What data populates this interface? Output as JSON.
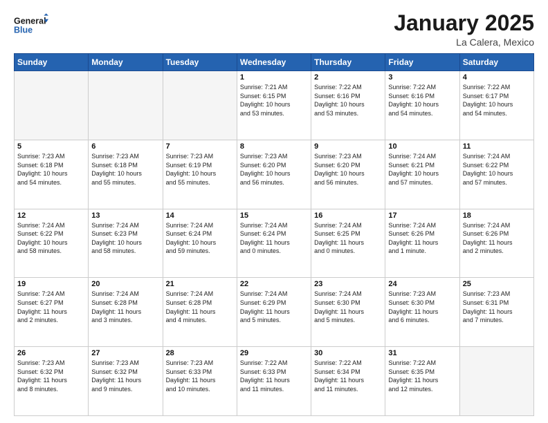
{
  "header": {
    "logo_line1": "General",
    "logo_line2": "Blue",
    "title": "January 2025",
    "subtitle": "La Calera, Mexico"
  },
  "weekdays": [
    "Sunday",
    "Monday",
    "Tuesday",
    "Wednesday",
    "Thursday",
    "Friday",
    "Saturday"
  ],
  "weeks": [
    [
      {
        "day": "",
        "info": ""
      },
      {
        "day": "",
        "info": ""
      },
      {
        "day": "",
        "info": ""
      },
      {
        "day": "1",
        "info": "Sunrise: 7:21 AM\nSunset: 6:15 PM\nDaylight: 10 hours\nand 53 minutes."
      },
      {
        "day": "2",
        "info": "Sunrise: 7:22 AM\nSunset: 6:16 PM\nDaylight: 10 hours\nand 53 minutes."
      },
      {
        "day": "3",
        "info": "Sunrise: 7:22 AM\nSunset: 6:16 PM\nDaylight: 10 hours\nand 54 minutes."
      },
      {
        "day": "4",
        "info": "Sunrise: 7:22 AM\nSunset: 6:17 PM\nDaylight: 10 hours\nand 54 minutes."
      }
    ],
    [
      {
        "day": "5",
        "info": "Sunrise: 7:23 AM\nSunset: 6:18 PM\nDaylight: 10 hours\nand 54 minutes."
      },
      {
        "day": "6",
        "info": "Sunrise: 7:23 AM\nSunset: 6:18 PM\nDaylight: 10 hours\nand 55 minutes."
      },
      {
        "day": "7",
        "info": "Sunrise: 7:23 AM\nSunset: 6:19 PM\nDaylight: 10 hours\nand 55 minutes."
      },
      {
        "day": "8",
        "info": "Sunrise: 7:23 AM\nSunset: 6:20 PM\nDaylight: 10 hours\nand 56 minutes."
      },
      {
        "day": "9",
        "info": "Sunrise: 7:23 AM\nSunset: 6:20 PM\nDaylight: 10 hours\nand 56 minutes."
      },
      {
        "day": "10",
        "info": "Sunrise: 7:24 AM\nSunset: 6:21 PM\nDaylight: 10 hours\nand 57 minutes."
      },
      {
        "day": "11",
        "info": "Sunrise: 7:24 AM\nSunset: 6:22 PM\nDaylight: 10 hours\nand 57 minutes."
      }
    ],
    [
      {
        "day": "12",
        "info": "Sunrise: 7:24 AM\nSunset: 6:22 PM\nDaylight: 10 hours\nand 58 minutes."
      },
      {
        "day": "13",
        "info": "Sunrise: 7:24 AM\nSunset: 6:23 PM\nDaylight: 10 hours\nand 58 minutes."
      },
      {
        "day": "14",
        "info": "Sunrise: 7:24 AM\nSunset: 6:24 PM\nDaylight: 10 hours\nand 59 minutes."
      },
      {
        "day": "15",
        "info": "Sunrise: 7:24 AM\nSunset: 6:24 PM\nDaylight: 11 hours\nand 0 minutes."
      },
      {
        "day": "16",
        "info": "Sunrise: 7:24 AM\nSunset: 6:25 PM\nDaylight: 11 hours\nand 0 minutes."
      },
      {
        "day": "17",
        "info": "Sunrise: 7:24 AM\nSunset: 6:26 PM\nDaylight: 11 hours\nand 1 minute."
      },
      {
        "day": "18",
        "info": "Sunrise: 7:24 AM\nSunset: 6:26 PM\nDaylight: 11 hours\nand 2 minutes."
      }
    ],
    [
      {
        "day": "19",
        "info": "Sunrise: 7:24 AM\nSunset: 6:27 PM\nDaylight: 11 hours\nand 2 minutes."
      },
      {
        "day": "20",
        "info": "Sunrise: 7:24 AM\nSunset: 6:28 PM\nDaylight: 11 hours\nand 3 minutes."
      },
      {
        "day": "21",
        "info": "Sunrise: 7:24 AM\nSunset: 6:28 PM\nDaylight: 11 hours\nand 4 minutes."
      },
      {
        "day": "22",
        "info": "Sunrise: 7:24 AM\nSunset: 6:29 PM\nDaylight: 11 hours\nand 5 minutes."
      },
      {
        "day": "23",
        "info": "Sunrise: 7:24 AM\nSunset: 6:30 PM\nDaylight: 11 hours\nand 5 minutes."
      },
      {
        "day": "24",
        "info": "Sunrise: 7:23 AM\nSunset: 6:30 PM\nDaylight: 11 hours\nand 6 minutes."
      },
      {
        "day": "25",
        "info": "Sunrise: 7:23 AM\nSunset: 6:31 PM\nDaylight: 11 hours\nand 7 minutes."
      }
    ],
    [
      {
        "day": "26",
        "info": "Sunrise: 7:23 AM\nSunset: 6:32 PM\nDaylight: 11 hours\nand 8 minutes."
      },
      {
        "day": "27",
        "info": "Sunrise: 7:23 AM\nSunset: 6:32 PM\nDaylight: 11 hours\nand 9 minutes."
      },
      {
        "day": "28",
        "info": "Sunrise: 7:23 AM\nSunset: 6:33 PM\nDaylight: 11 hours\nand 10 minutes."
      },
      {
        "day": "29",
        "info": "Sunrise: 7:22 AM\nSunset: 6:33 PM\nDaylight: 11 hours\nand 11 minutes."
      },
      {
        "day": "30",
        "info": "Sunrise: 7:22 AM\nSunset: 6:34 PM\nDaylight: 11 hours\nand 11 minutes."
      },
      {
        "day": "31",
        "info": "Sunrise: 7:22 AM\nSunset: 6:35 PM\nDaylight: 11 hours\nand 12 minutes."
      },
      {
        "day": "",
        "info": ""
      }
    ]
  ]
}
